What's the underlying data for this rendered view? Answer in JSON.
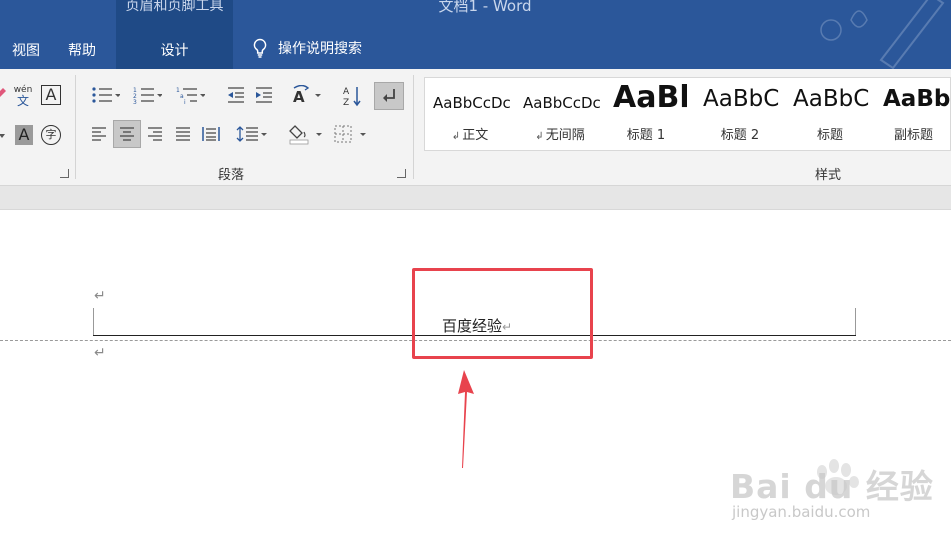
{
  "window": {
    "context_group": "页眉和页脚工具",
    "doc_title": "文档1  -  Word"
  },
  "tabs": {
    "view": "视图",
    "help": "帮助",
    "design": "设计"
  },
  "tell_me": {
    "label": "操作说明搜索",
    "icon": "lightbulb-icon"
  },
  "ribbon": {
    "paragraph_group_label": "段落",
    "styles_group_label": "样式",
    "phonetic_glyph_top": "wén",
    "phonetic_glyph_bottom": "文",
    "char_border_glyph": "A",
    "char_shading_glyph": "A",
    "enclose_glyph": "字",
    "styles": [
      {
        "preview": "AaBbCcDc",
        "name": "正文",
        "mark": "↲"
      },
      {
        "preview": "AaBbCcDc",
        "name": "无间隔",
        "mark": "↲"
      },
      {
        "preview": "AaBl",
        "name": "标题 1",
        "mark": ""
      },
      {
        "preview": "AaBbC",
        "name": "标题 2",
        "mark": ""
      },
      {
        "preview": "AaBbC",
        "name": "标题",
        "mark": ""
      },
      {
        "preview": "AaBbC",
        "name": "副标题",
        "mark": ""
      }
    ]
  },
  "document": {
    "header_text": "百度经验",
    "para_mark": "↵"
  },
  "colors": {
    "title_bar": "#2b579a",
    "context_tab": "#1f4a86",
    "highlight": "#e8434d"
  },
  "watermark": {
    "brand": "Bai du 经验",
    "url": "jingyan.baidu.com"
  }
}
